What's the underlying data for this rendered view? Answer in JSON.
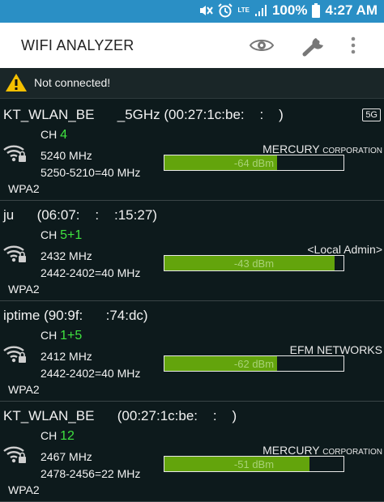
{
  "status_bar": {
    "lte_label": "LTE",
    "battery": "100%",
    "time": "4:27 AM",
    "icons": [
      "mute-icon",
      "alarm-icon",
      "lte-icon",
      "signal-icon",
      "battery-icon"
    ]
  },
  "appbar": {
    "title": "WIFI ANALYZER",
    "icons": [
      "eye-icon",
      "wrench-icon",
      "overflow-menu-icon"
    ]
  },
  "warning": {
    "icon": "warning-icon",
    "text": "Not connected!"
  },
  "networks": [
    {
      "ssid": "KT_WLAN_BE      _5GHz (00:27:1c:be:    :    )",
      "channel_label": "CH",
      "channel": "4",
      "frequency": "5240 MHz",
      "range": "5250-5210=40 MHz",
      "security": "WPA2",
      "vendor": "MERCURY",
      "vendor_suffix": "CORPORATION",
      "band": "5G",
      "signal": "-64 dBm",
      "signal_level": 0.63,
      "icon": "wifi-locked-icon"
    },
    {
      "ssid": "ju      (06:07:    :    :15:27)",
      "channel_label": "CH",
      "channel": "5+1",
      "frequency": "2432 MHz",
      "range": "2442-2402=40 MHz",
      "security": "WPA2",
      "vendor": "<Local Admin>",
      "vendor_suffix": "",
      "band": "",
      "signal": "-43 dBm",
      "signal_level": 0.95,
      "icon": "wifi-locked-icon"
    },
    {
      "ssid": "iptime (90:9f:      :74:dc)",
      "channel_label": "CH",
      "channel": "1+5",
      "frequency": "2412 MHz",
      "range": "2442-2402=40 MHz",
      "security": "WPA2",
      "vendor": "EFM NETWORKS",
      "vendor_suffix": "",
      "band": "",
      "signal": "-62 dBm",
      "signal_level": 0.63,
      "icon": "wifi-locked-icon"
    },
    {
      "ssid": "KT_WLAN_BE      (00:27:1c:be:    :    )",
      "channel_label": "CH",
      "channel": "12",
      "frequency": "2467 MHz",
      "range": "2478-2456=22 MHz",
      "security": "WPA2",
      "vendor": "MERCURY",
      "vendor_suffix": "CORPORATION",
      "band": "",
      "signal": "-51 dBm",
      "signal_level": 0.81,
      "icon": "wifi-locked-icon"
    }
  ],
  "colors": {
    "status_bar": "#2a8fc5",
    "background": "#0d1a1c",
    "channel": "#3fe23f",
    "signal_fill": "#63a40c",
    "warning": "#f5c000"
  }
}
